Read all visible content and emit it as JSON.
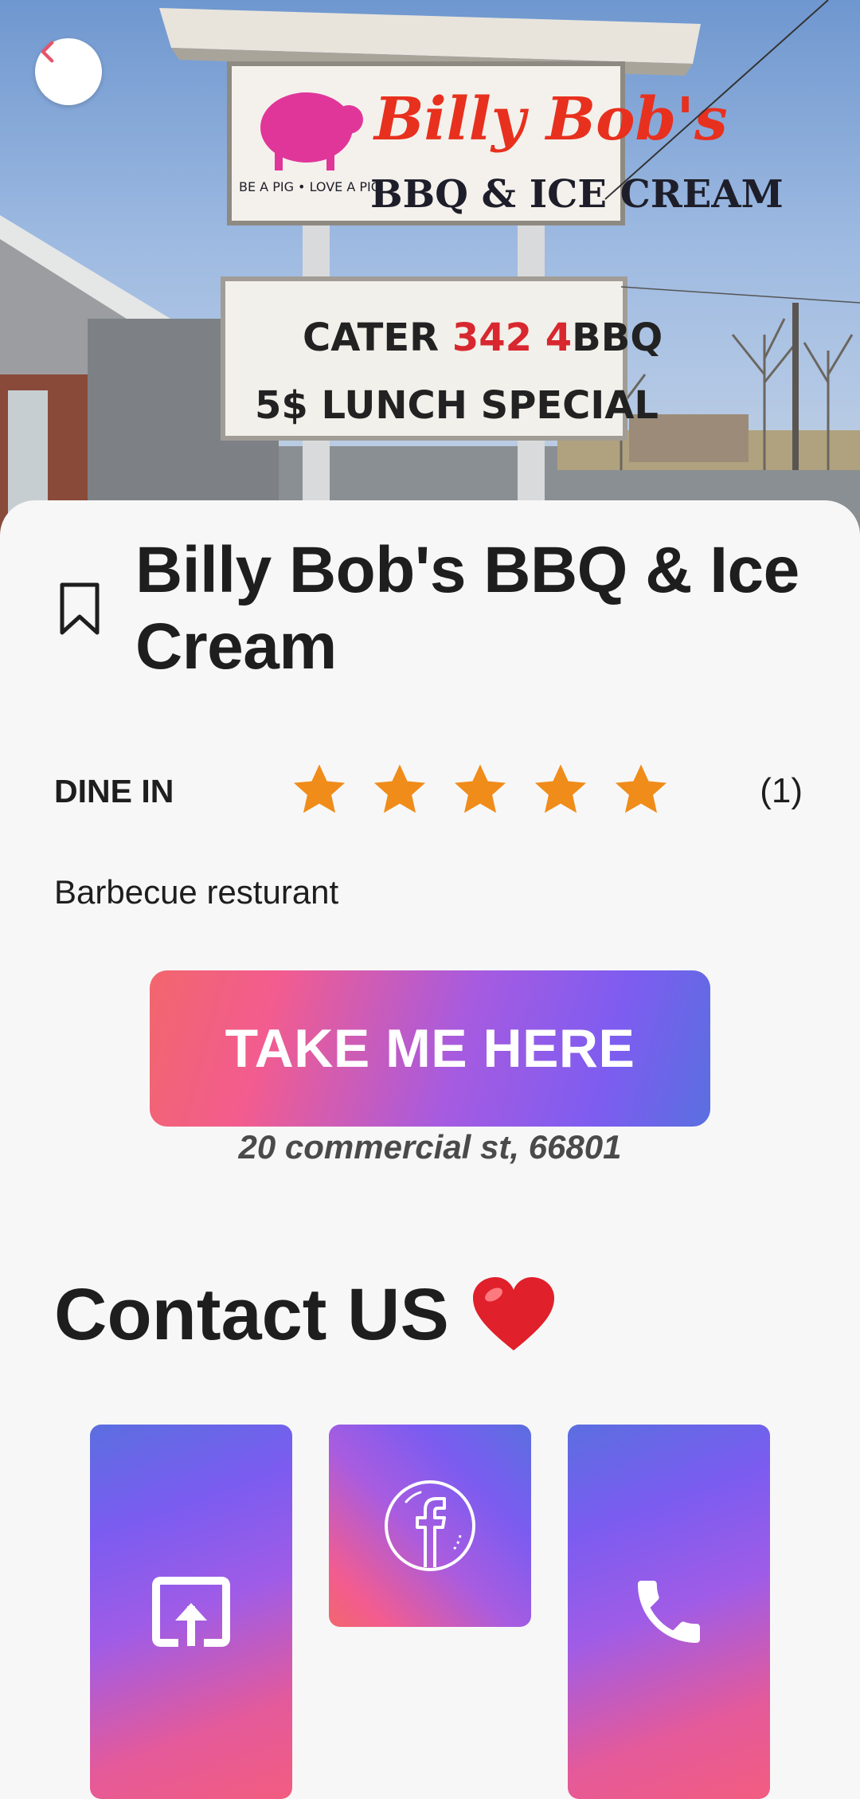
{
  "hero": {
    "sign_name": "Billy Bob's",
    "sign_sub": "BBQ & ICE CREAM",
    "sign_tagline": "BE A PIG • LOVE A PIG",
    "marquee_line1_a": "CATER ",
    "marquee_line1_b": "342 4",
    "marquee_line1_c": "BBQ",
    "marquee_line2": "5$ LUNCH SPECIAL",
    "back_icon": "chevron-left-icon"
  },
  "place": {
    "name": "Billy Bob's BBQ & Ice Cream",
    "service_type": "DINE IN",
    "rating": 5,
    "rating_max": 5,
    "review_count": "(1)",
    "category": "Barbecue resturant",
    "address": "20 commercial st, 66801"
  },
  "cta": {
    "label": "TAKE ME HERE"
  },
  "contact": {
    "heading": "Contact US",
    "icons": [
      "share-icon",
      "facebook-icon",
      "phone-icon"
    ]
  },
  "colors": {
    "star": "#f08c1a",
    "accent_start": "#f2666d",
    "accent_end": "#5a6fe0",
    "back_chevron": "#e5546a"
  }
}
